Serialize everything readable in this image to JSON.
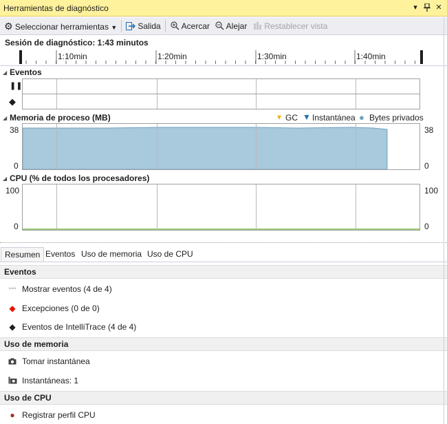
{
  "window": {
    "title": "Herramientas de diagnóstico"
  },
  "toolbar": {
    "select_tools": "Seleccionar herramientas",
    "exit": "Salida",
    "zoom_in": "Acercar",
    "zoom_out": "Alejar",
    "reset_view": "Restablecer vista"
  },
  "session": {
    "label": "Sesión de diagnóstico: 1:43 minutos"
  },
  "ruler": {
    "ticks": [
      "1:10min",
      "1:20min",
      "1:30min",
      "1:40min"
    ]
  },
  "events_lane": {
    "title": "Eventos"
  },
  "memory_lane": {
    "title": "Memoria de proceso (MB)",
    "legend": [
      "GC",
      "Instantánea",
      "Bytes privados"
    ],
    "y_max": "38",
    "y_min": "0"
  },
  "cpu_lane": {
    "title": "CPU (% de todos los procesadores)",
    "y_max": "100",
    "y_min": "0"
  },
  "tabs": [
    "Resumen",
    "Eventos",
    "Uso de memoria",
    "Uso de CPU"
  ],
  "summary": {
    "events": {
      "header": "Eventos",
      "rows": [
        "Mostrar eventos (4 de 4)",
        "Excepciones (0 de 0)",
        "Eventos de IntelliTrace (4 de 4)"
      ]
    },
    "memory": {
      "header": "Uso de memoria",
      "rows": [
        "Tomar instantánea",
        "Instantáneas: 1"
      ]
    },
    "cpu": {
      "header": "Uso de CPU",
      "rows": [
        "Registrar perfil CPU"
      ]
    }
  },
  "colors": {
    "title_bar": "#fff29d",
    "memory_fill": "#a9c9dc",
    "memory_stroke": "#6fa1c2",
    "gc_marker": "#f0b400",
    "snapshot_marker": "#1f6fb2",
    "exception_icon": "#e51400",
    "record_icon": "#a52a2a"
  }
}
